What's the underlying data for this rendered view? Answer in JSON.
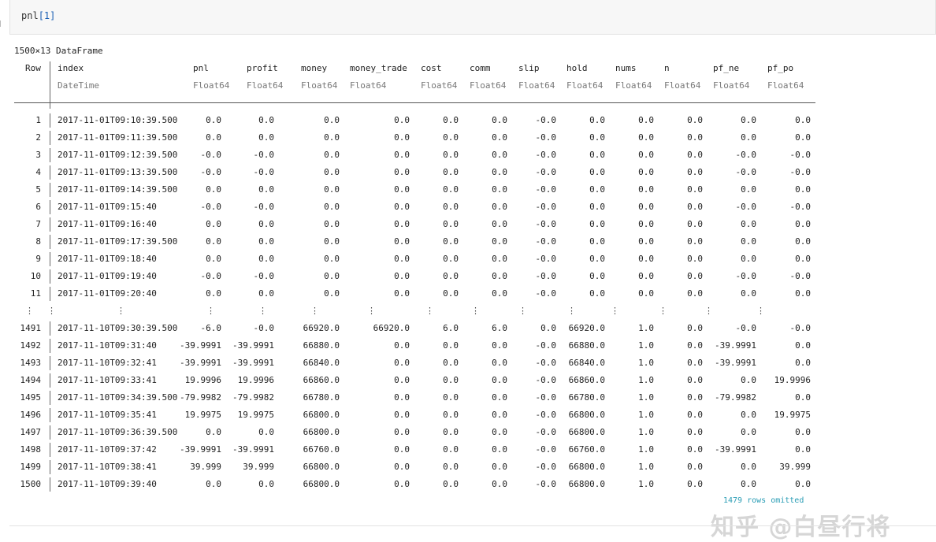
{
  "cell": {
    "code_prefix": "pnl",
    "code_bracket": "[1]"
  },
  "dataframe": {
    "title": "1500×13 DataFrame",
    "columns": [
      {
        "name": "Row",
        "type": ""
      },
      {
        "name": "index",
        "type": "DateTime"
      },
      {
        "name": "pnl",
        "type": "Float64"
      },
      {
        "name": "profit",
        "type": "Float64"
      },
      {
        "name": "money",
        "type": "Float64"
      },
      {
        "name": "money_trade",
        "type": "Float64"
      },
      {
        "name": "cost",
        "type": "Float64"
      },
      {
        "name": "comm",
        "type": "Float64"
      },
      {
        "name": "slip",
        "type": "Float64"
      },
      {
        "name": "hold",
        "type": "Float64"
      },
      {
        "name": "nums",
        "type": "Float64"
      },
      {
        "name": "n",
        "type": "Float64"
      },
      {
        "name": "pf_ne",
        "type": "Float64"
      },
      {
        "name": "pf_po",
        "type": "Float64"
      }
    ],
    "rows_top": [
      [
        "1",
        "2017-11-01T09:10:39.500",
        "0.0",
        "0.0",
        "0.0",
        "0.0",
        "0.0",
        "0.0",
        "-0.0",
        "0.0",
        "0.0",
        "0.0",
        "0.0",
        "0.0"
      ],
      [
        "2",
        "2017-11-01T09:11:39.500",
        "0.0",
        "0.0",
        "0.0",
        "0.0",
        "0.0",
        "0.0",
        "-0.0",
        "0.0",
        "0.0",
        "0.0",
        "0.0",
        "0.0"
      ],
      [
        "3",
        "2017-11-01T09:12:39.500",
        "-0.0",
        "-0.0",
        "0.0",
        "0.0",
        "0.0",
        "0.0",
        "-0.0",
        "0.0",
        "0.0",
        "0.0",
        "-0.0",
        "-0.0"
      ],
      [
        "4",
        "2017-11-01T09:13:39.500",
        "-0.0",
        "-0.0",
        "0.0",
        "0.0",
        "0.0",
        "0.0",
        "-0.0",
        "0.0",
        "0.0",
        "0.0",
        "-0.0",
        "-0.0"
      ],
      [
        "5",
        "2017-11-01T09:14:39.500",
        "0.0",
        "0.0",
        "0.0",
        "0.0",
        "0.0",
        "0.0",
        "-0.0",
        "0.0",
        "0.0",
        "0.0",
        "0.0",
        "0.0"
      ],
      [
        "6",
        "2017-11-01T09:15:40",
        "-0.0",
        "-0.0",
        "0.0",
        "0.0",
        "0.0",
        "0.0",
        "-0.0",
        "0.0",
        "0.0",
        "0.0",
        "-0.0",
        "-0.0"
      ],
      [
        "7",
        "2017-11-01T09:16:40",
        "0.0",
        "0.0",
        "0.0",
        "0.0",
        "0.0",
        "0.0",
        "-0.0",
        "0.0",
        "0.0",
        "0.0",
        "0.0",
        "0.0"
      ],
      [
        "8",
        "2017-11-01T09:17:39.500",
        "0.0",
        "0.0",
        "0.0",
        "0.0",
        "0.0",
        "0.0",
        "-0.0",
        "0.0",
        "0.0",
        "0.0",
        "0.0",
        "0.0"
      ],
      [
        "9",
        "2017-11-01T09:18:40",
        "0.0",
        "0.0",
        "0.0",
        "0.0",
        "0.0",
        "0.0",
        "-0.0",
        "0.0",
        "0.0",
        "0.0",
        "0.0",
        "0.0"
      ],
      [
        "10",
        "2017-11-01T09:19:40",
        "-0.0",
        "-0.0",
        "0.0",
        "0.0",
        "0.0",
        "0.0",
        "-0.0",
        "0.0",
        "0.0",
        "0.0",
        "-0.0",
        "-0.0"
      ],
      [
        "11",
        "2017-11-01T09:20:40",
        "0.0",
        "0.0",
        "0.0",
        "0.0",
        "0.0",
        "0.0",
        "-0.0",
        "0.0",
        "0.0",
        "0.0",
        "0.0",
        "0.0"
      ]
    ],
    "ellipsis": "⋮",
    "rows_bottom": [
      [
        "1491",
        "2017-11-10T09:30:39.500",
        "-6.0",
        "-0.0",
        "66920.0",
        "66920.0",
        "6.0",
        "6.0",
        "0.0",
        "66920.0",
        "1.0",
        "0.0",
        "-0.0",
        "-0.0"
      ],
      [
        "1492",
        "2017-11-10T09:31:40",
        "-39.9991",
        "-39.9991",
        "66880.0",
        "0.0",
        "0.0",
        "0.0",
        "-0.0",
        "66880.0",
        "1.0",
        "0.0",
        "-39.9991",
        "0.0"
      ],
      [
        "1493",
        "2017-11-10T09:32:41",
        "-39.9991",
        "-39.9991",
        "66840.0",
        "0.0",
        "0.0",
        "0.0",
        "-0.0",
        "66840.0",
        "1.0",
        "0.0",
        "-39.9991",
        "0.0"
      ],
      [
        "1494",
        "2017-11-10T09:33:41",
        "19.9996",
        "19.9996",
        "66860.0",
        "0.0",
        "0.0",
        "0.0",
        "-0.0",
        "66860.0",
        "1.0",
        "0.0",
        "0.0",
        "19.9996"
      ],
      [
        "1495",
        "2017-11-10T09:34:39.500",
        "-79.9982",
        "-79.9982",
        "66780.0",
        "0.0",
        "0.0",
        "0.0",
        "-0.0",
        "66780.0",
        "1.0",
        "0.0",
        "-79.9982",
        "0.0"
      ],
      [
        "1496",
        "2017-11-10T09:35:41",
        "19.9975",
        "19.9975",
        "66800.0",
        "0.0",
        "0.0",
        "0.0",
        "-0.0",
        "66800.0",
        "1.0",
        "0.0",
        "0.0",
        "19.9975"
      ],
      [
        "1497",
        "2017-11-10T09:36:39.500",
        "0.0",
        "0.0",
        "66800.0",
        "0.0",
        "0.0",
        "0.0",
        "-0.0",
        "66800.0",
        "1.0",
        "0.0",
        "0.0",
        "0.0"
      ],
      [
        "1498",
        "2017-11-10T09:37:42",
        "-39.9991",
        "-39.9991",
        "66760.0",
        "0.0",
        "0.0",
        "0.0",
        "-0.0",
        "66760.0",
        "1.0",
        "0.0",
        "-39.9991",
        "0.0"
      ],
      [
        "1499",
        "2017-11-10T09:38:41",
        "39.999",
        "39.999",
        "66800.0",
        "0.0",
        "0.0",
        "0.0",
        "-0.0",
        "66800.0",
        "1.0",
        "0.0",
        "0.0",
        "39.999"
      ],
      [
        "1500",
        "2017-11-10T09:39:40",
        "0.0",
        "0.0",
        "66800.0",
        "0.0",
        "0.0",
        "0.0",
        "-0.0",
        "66800.0",
        "1.0",
        "0.0",
        "0.0",
        "0.0"
      ]
    ],
    "omitted_note": "1479 rows omitted"
  },
  "watermark": "知乎 @白昼行将"
}
